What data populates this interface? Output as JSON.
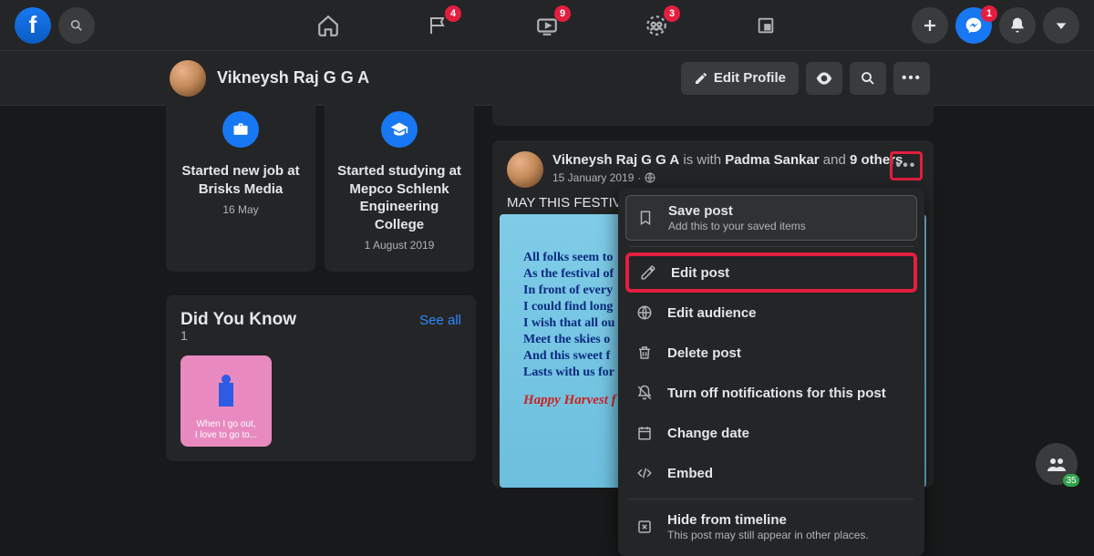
{
  "nav": {
    "badges": {
      "pages": "4",
      "watch": "9",
      "groups": "3",
      "messenger": "1"
    }
  },
  "subheader": {
    "username": "Vikneysh Raj G G A",
    "edit_profile": "Edit Profile"
  },
  "life_events": [
    {
      "title": "Started new job at Brisks Media",
      "date": "16 May"
    },
    {
      "title": "Started studying at Mepco Schlenk Engineering College",
      "date": "1 August 2019"
    }
  ],
  "dyk": {
    "title": "Did You Know",
    "see_all": "See all",
    "count": "1",
    "tile_text_1": "When I go out,",
    "tile_text_2": "I love to go to..."
  },
  "post": {
    "author": "Vikneysh Raj G G A",
    "is_with": " is with ",
    "tag1": "Padma Sankar",
    "and": " and ",
    "tag2": "9 others",
    "date": "15 January 2019",
    "text": "MAY THIS FESTIVA",
    "poem": [
      "All folks seem to",
      "As the festival of",
      "In front of every",
      "I could find long",
      "I wish that all ou",
      "Meet the skies o",
      "And this sweet  f",
      "Lasts with us for"
    ],
    "happy": "Happy Harvest f"
  },
  "menu": {
    "save": "Save post",
    "save_sub": "Add this to your saved items",
    "edit": "Edit post",
    "audience": "Edit audience",
    "delete": "Delete post",
    "notify": "Turn off notifications for this post",
    "date": "Change date",
    "embed": "Embed",
    "hide": "Hide from timeline",
    "hide_sub": "This post may still appear in other places."
  },
  "fab": {
    "count": "35"
  }
}
